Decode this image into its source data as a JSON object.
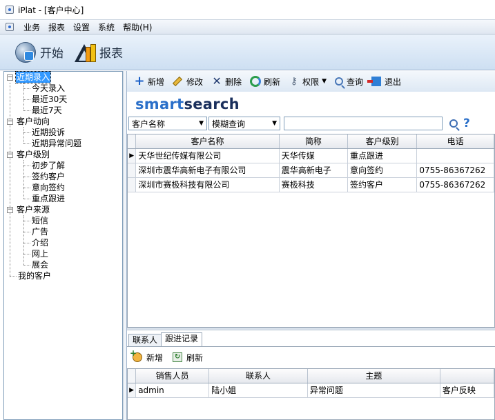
{
  "window": {
    "title": "iPlat - [客户中心]"
  },
  "menu": {
    "items": [
      "业务",
      "报表",
      "设置",
      "系统",
      "帮助(H)"
    ]
  },
  "bigbar": {
    "start_label": "开始",
    "report_label": "报表"
  },
  "tree": {
    "groups": [
      {
        "label": "近期录入",
        "selected": true,
        "children": [
          "今天录入",
          "最近30天",
          "最近7天"
        ]
      },
      {
        "label": "客户动向",
        "children": [
          "近期投诉",
          "近期异常问题"
        ]
      },
      {
        "label": "客户级别",
        "children": [
          "初步了解",
          "签约客户",
          "意向签约",
          "重点跟进"
        ]
      },
      {
        "label": "客户来源",
        "children": [
          "短信",
          "广告",
          "介绍",
          "网上",
          "展会"
        ]
      }
    ],
    "leaf": "我的客户"
  },
  "toolbar": {
    "add": "新增",
    "edit": "修改",
    "delete": "删除",
    "refresh": "刷新",
    "perm": "权限",
    "query": "查询",
    "exit": "退出"
  },
  "logo": {
    "part1": "smart",
    "part2": "search"
  },
  "search": {
    "field": "客户名称",
    "mode": "模糊查询",
    "value": ""
  },
  "customers": {
    "columns": [
      "客户名称",
      "简称",
      "客户级别",
      "电话"
    ],
    "rows": [
      [
        "天华世纪传媒有限公司",
        "天华传媒",
        "重点跟进",
        ""
      ],
      [
        "深圳市震华高新电子有限公司",
        "震华高新电子",
        "意向签约",
        "0755-86367262"
      ],
      [
        "深圳市赛极科技有限公司",
        "赛极科技",
        "签约客户",
        "0755-86367262"
      ]
    ]
  },
  "tabs": {
    "contacts": "联系人",
    "followup": "跟进记录"
  },
  "subbar": {
    "add": "新增",
    "refresh": "刷新"
  },
  "followups": {
    "columns": [
      "销售人员",
      "联系人",
      "主题",
      ""
    ],
    "rows": [
      [
        "admin",
        "陆小姐",
        "异常问题",
        "客户反映"
      ]
    ]
  }
}
